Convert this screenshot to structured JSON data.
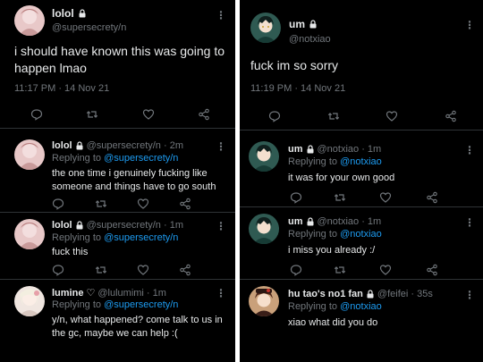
{
  "left": {
    "main": {
      "name": "lolol",
      "handle": "@supersecrety/n",
      "text": "i should have known this was going to happen lmao",
      "meta": "11:17 PM · 14 Nov 21"
    },
    "replies": [
      {
        "name": "lolol",
        "handle": "@supersecrety/n · 2m",
        "replying_prefix": "Replying to",
        "replying_to": "@supersecrety/n",
        "text": "the one time i genuinely fucking like someone and things have to go south"
      },
      {
        "name": "lolol",
        "handle": "@supersecrety/n · 1m",
        "replying_prefix": "Replying to",
        "replying_to": "@supersecrety/n",
        "text": "fuck this"
      },
      {
        "name": "lumine ♡",
        "handle": "@lulumimi · 1m",
        "replying_prefix": "Replying to",
        "replying_to": "@supersecrety/n",
        "text": "y/n, what happened? come talk to us in the gc, maybe we can help :("
      }
    ]
  },
  "right": {
    "main": {
      "name": "um",
      "handle": "@notxiao",
      "text": "fuck im so sorry",
      "meta": "11:19 PM · 14 Nov 21"
    },
    "replies": [
      {
        "name": "um",
        "handle": "@notxiao · 1m",
        "replying_prefix": "Replying to",
        "replying_to": "@notxiao",
        "text": "it was for your own good"
      },
      {
        "name": "um",
        "handle": "@notxiao · 1m",
        "replying_prefix": "Replying to",
        "replying_to": "@notxiao",
        "text": "i miss you already :/"
      },
      {
        "name": "hu tao's no1 fan",
        "handle": "@feifei · 35s",
        "replying_prefix": "Replying to",
        "replying_to": "@notxiao",
        "text": "xiao what did you do"
      }
    ]
  },
  "colors": {
    "background": "#000000",
    "text": "#e7e9ea",
    "muted": "#71767b",
    "link": "#1d9bf0",
    "divider": "#2f3336"
  },
  "icons": [
    "lock-icon",
    "more-dots-icon",
    "reply-icon",
    "retweet-icon",
    "like-icon",
    "share-icon"
  ]
}
